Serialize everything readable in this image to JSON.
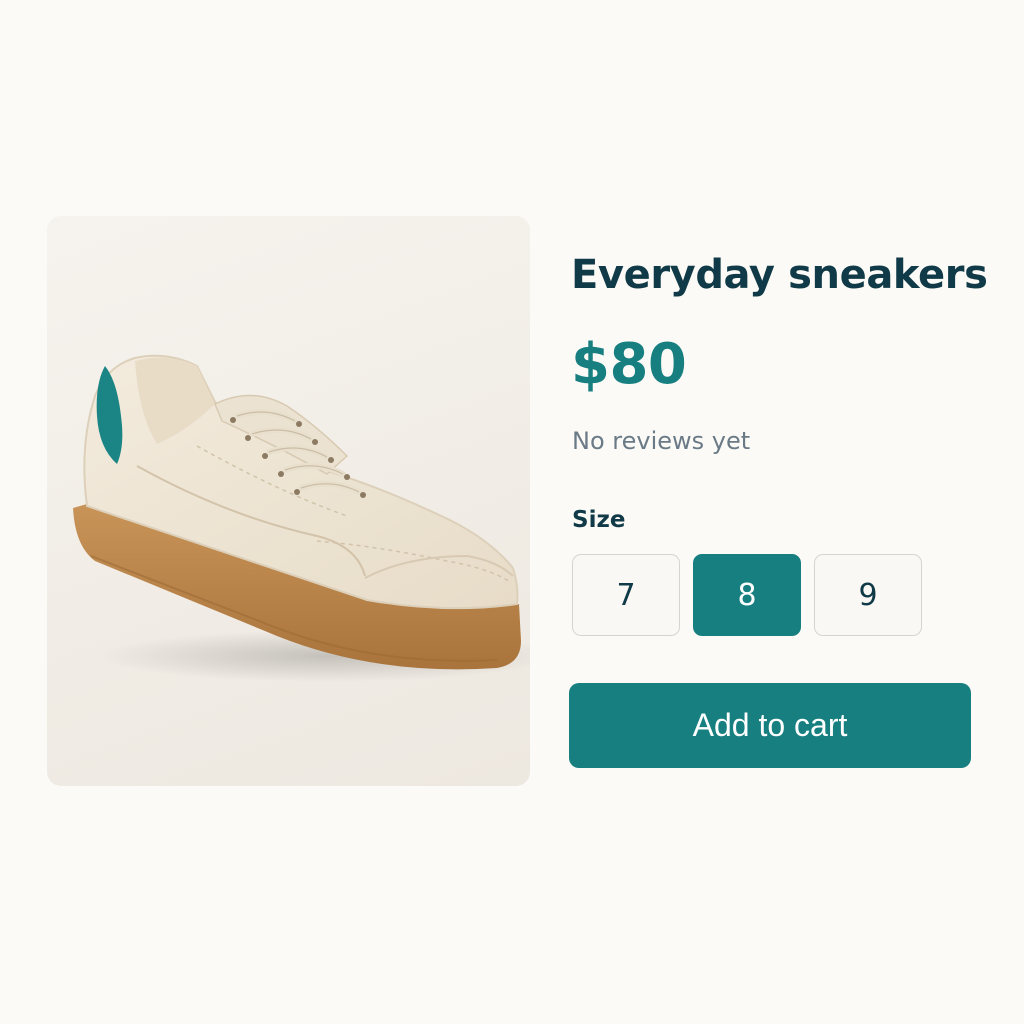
{
  "product": {
    "title": "Everyday sneakers",
    "price": "$80",
    "reviews_text": "No reviews yet",
    "image_icon": "sneaker-image"
  },
  "size_selector": {
    "label": "Size",
    "options": [
      "7",
      "8",
      "9"
    ],
    "selected": "8"
  },
  "cart": {
    "button_label": "Add to cart"
  },
  "colors": {
    "accent": "#177f80",
    "heading": "#103a47",
    "muted_text": "#6a7a86",
    "page_background": "#fbfaf6",
    "card_background": "#f3f0ea",
    "shoe_upper": "#efe6d6",
    "shoe_sole": "#c08a4f",
    "shoe_heel_tab": "#1b8585"
  }
}
